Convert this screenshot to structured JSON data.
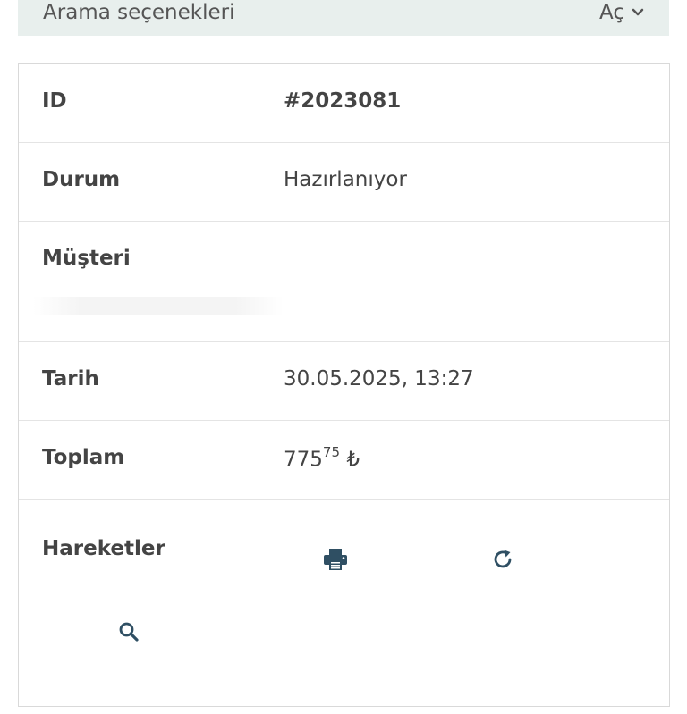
{
  "search_options": {
    "label": "Arama seçenekleri",
    "toggle_label": "Aç"
  },
  "order": {
    "rows": {
      "id": {
        "label": "ID",
        "value": "#2023081"
      },
      "status": {
        "label": "Durum",
        "value": "Hazırlanıyor"
      },
      "customer": {
        "label": "Müşteri",
        "value": ""
      },
      "date": {
        "label": "Tarih",
        "value": "30.05.2025, 13:27"
      },
      "total": {
        "label": "Toplam",
        "integer": "775",
        "decimal": "75",
        "currency": "₺"
      },
      "actions": {
        "label": "Hareketler"
      }
    }
  },
  "icons": {
    "print": "print-icon",
    "refresh": "refresh-icon",
    "search": "search-icon"
  },
  "colors": {
    "icon": "#2f4f63",
    "search_bar_bg": "#e8efed",
    "text": "#444444"
  }
}
